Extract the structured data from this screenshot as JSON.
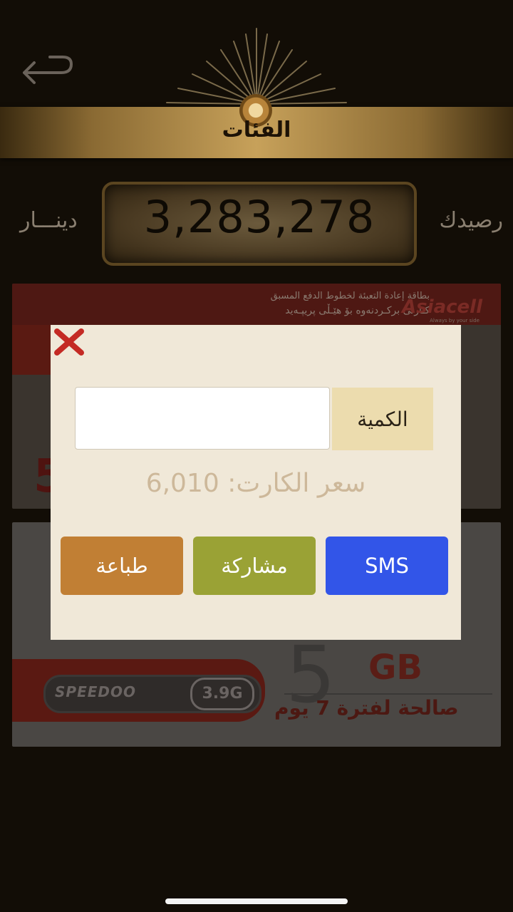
{
  "header": {
    "title": "الفئات",
    "back_icon": "back-arrow-icon"
  },
  "balance": {
    "label": "رصيدك",
    "value": "3,283,278",
    "currency": "دينـــار"
  },
  "cards": [
    {
      "brand": "Asiacell",
      "tagline": "Always by your side",
      "line1": "بطاقة إعادة التعبئة لخطوط الدفع المسبق",
      "line2": "كـارتى بركـردنەوه بۆ هێـڵى پريپـەيد",
      "digit": "5"
    },
    {
      "speedoo": "SPEEDOO",
      "speedoo_gen": "3.9G",
      "digit": "5",
      "unit": "GB",
      "validity": "صالحة لفترة 7 يوم"
    }
  ],
  "modal": {
    "close_icon": "close-x-icon",
    "quantity_label": "الكمية",
    "quantity_value": "",
    "price_text": "سعر الكارت: 6,010",
    "buttons": {
      "print": "طباعة",
      "share": "مشاركة",
      "sms": "SMS"
    }
  },
  "colors": {
    "print": "#c17f34",
    "share": "#9aa235",
    "sms": "#3255e8",
    "close": "#c42a24"
  }
}
